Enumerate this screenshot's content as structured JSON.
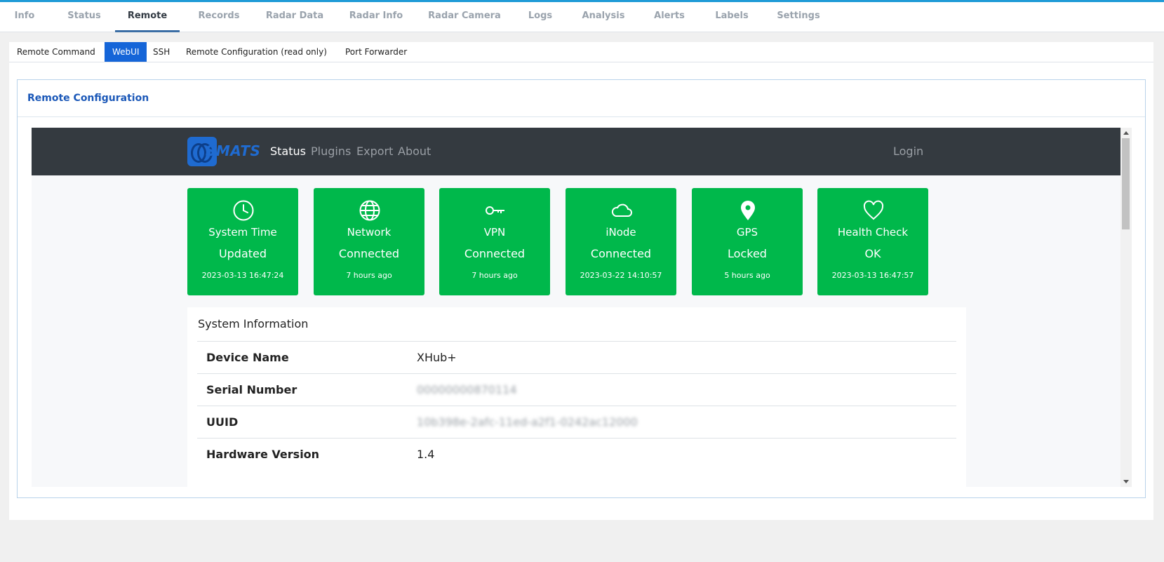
{
  "main_tabs": [
    {
      "label": "Info"
    },
    {
      "label": "Status"
    },
    {
      "label": "Remote"
    },
    {
      "label": "Records"
    },
    {
      "label": "Radar Data"
    },
    {
      "label": "Radar Info"
    },
    {
      "label": "Radar Camera"
    },
    {
      "label": "Logs"
    },
    {
      "label": "Analysis"
    },
    {
      "label": "Alerts"
    },
    {
      "label": "Labels"
    },
    {
      "label": "Settings"
    }
  ],
  "main_tabs_active": "Remote",
  "sub_tabs": [
    {
      "label": "Remote Command"
    },
    {
      "label": "WebUI"
    },
    {
      "label": "SSH"
    },
    {
      "label": "Remote Configuration (read only)"
    },
    {
      "label": "Port Forwarder"
    }
  ],
  "sub_tabs_active": "WebUI",
  "card": {
    "title": "Remote Configuration"
  },
  "webui": {
    "logo_text": "SMATS",
    "nav": [
      {
        "label": "Status"
      },
      {
        "label": "Plugins"
      },
      {
        "label": "Export"
      },
      {
        "label": "About"
      }
    ],
    "nav_active": "Status",
    "login_label": "Login",
    "tiles": [
      {
        "name": "System Time",
        "status": "Updated",
        "time": "2023-03-13 16:47:24",
        "icon": "clock-icon"
      },
      {
        "name": "Network",
        "status": "Connected",
        "time": "7 hours ago",
        "icon": "globe-icon"
      },
      {
        "name": "VPN",
        "status": "Connected",
        "time": "7 hours ago",
        "icon": "key-icon"
      },
      {
        "name": "iNode",
        "status": "Connected",
        "time": "2023-03-22 14:10:57",
        "icon": "cloud-icon"
      },
      {
        "name": "GPS",
        "status": "Locked",
        "time": "5 hours ago",
        "icon": "map-pin-icon"
      },
      {
        "name": "Health Check",
        "status": "OK",
        "time": "2023-03-13 16:47:57",
        "icon": "heart-icon"
      }
    ],
    "tile_color": "#00b84b",
    "system_info": {
      "title": "System Information",
      "rows": [
        {
          "key": "Device Name",
          "value": "XHub+"
        },
        {
          "key": "Serial Number",
          "value": "00000000870114"
        },
        {
          "key": "UUID",
          "value": "10b398e-2afc-11ed-a2f1-0242ac12000"
        },
        {
          "key": "Hardware Version",
          "value": "1.4"
        }
      ]
    }
  },
  "colors": {
    "accent": "#1565d8",
    "card_title": "#1b58b8",
    "navbar": "#343a40"
  }
}
